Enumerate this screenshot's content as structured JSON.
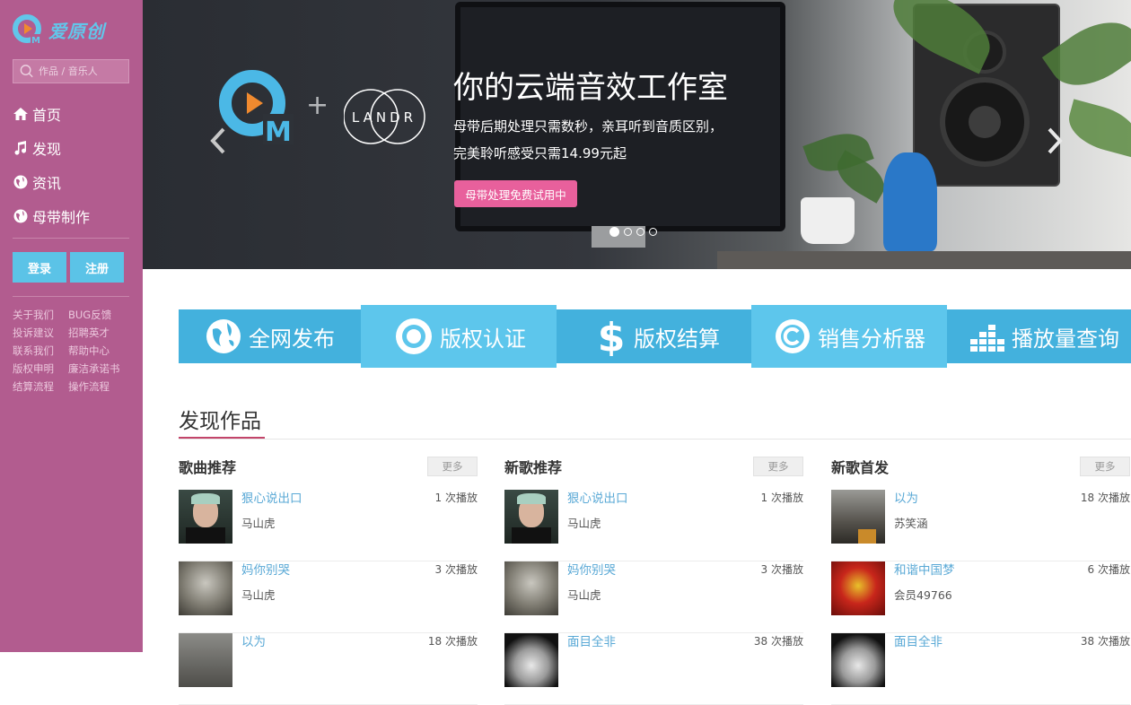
{
  "app": {
    "logo_text": "爱原创"
  },
  "search": {
    "placeholder": "作品 / 音乐人"
  },
  "nav": [
    {
      "label": "首页",
      "icon": "home-icon"
    },
    {
      "label": "发现",
      "icon": "music-note-icon"
    },
    {
      "label": "资讯",
      "icon": "globe-icon"
    },
    {
      "label": "母带制作",
      "icon": "globe-icon"
    }
  ],
  "auth": {
    "login": "登录",
    "register": "注册"
  },
  "footer_links": [
    "关于我们",
    "BUG反馈",
    "投诉建议",
    "招聘英才",
    "联系我们",
    "帮助中心",
    "版权申明",
    "廉洁承诺书",
    "结算流程",
    "操作流程"
  ],
  "banner": {
    "title": "你的云端音效工作室",
    "line1": "母带后期处理只需数秒，亲耳听到音质区别，",
    "line2": "完美聆听感受只需14.99元起",
    "cta": "母带处理免费试用中",
    "partner": "LANDR",
    "plus": "+",
    "slide_index": 1,
    "slide_count": 4
  },
  "features": [
    {
      "label": "全网发布",
      "icon": "globe-icon"
    },
    {
      "label": "版权认证",
      "icon": "target-icon"
    },
    {
      "label": "版权结算",
      "icon": "dollar-icon"
    },
    {
      "label": "销售分析器",
      "icon": "copyright-icon"
    },
    {
      "label": "播放量查询",
      "icon": "bar-chart-icon"
    }
  ],
  "discover": {
    "title": "发现作品",
    "columns": [
      {
        "title": "歌曲推荐",
        "more": "更多",
        "tracks": [
          {
            "name": "狠心说出口",
            "artist": "马山虎",
            "plays": "1 次播放"
          },
          {
            "name": "妈你别哭",
            "artist": "马山虎",
            "plays": "3 次播放"
          },
          {
            "name": "以为",
            "artist": "",
            "plays": "18 次播放"
          }
        ]
      },
      {
        "title": "新歌推荐",
        "more": "更多",
        "tracks": [
          {
            "name": "狠心说出口",
            "artist": "马山虎",
            "plays": "1 次播放"
          },
          {
            "name": "妈你别哭",
            "artist": "马山虎",
            "plays": "3 次播放"
          },
          {
            "name": "面目全非",
            "artist": "",
            "plays": "38 次播放"
          }
        ]
      },
      {
        "title": "新歌首发",
        "more": "更多",
        "tracks": [
          {
            "name": "以为",
            "artist": "苏笑涵",
            "plays": "18 次播放"
          },
          {
            "name": "和谐中国梦",
            "artist": "会员49766",
            "plays": "6 次播放"
          },
          {
            "name": "面目全非",
            "artist": "",
            "plays": "38 次播放"
          }
        ]
      }
    ]
  },
  "colors": {
    "sidebar": "#b25c8f",
    "accent_blue": "#5bc3e7",
    "accent_pink": "#e8609c",
    "link": "#5aa9d6"
  }
}
